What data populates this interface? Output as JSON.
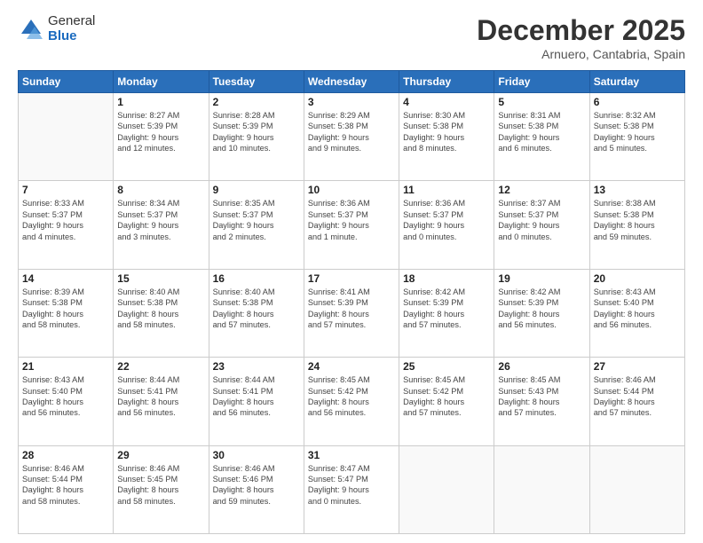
{
  "header": {
    "logo_general": "General",
    "logo_blue": "Blue",
    "month_title": "December 2025",
    "location": "Arnuero, Cantabria, Spain"
  },
  "weekdays": [
    "Sunday",
    "Monday",
    "Tuesday",
    "Wednesday",
    "Thursday",
    "Friday",
    "Saturday"
  ],
  "weeks": [
    [
      {
        "day": "",
        "lines": []
      },
      {
        "day": "1",
        "lines": [
          "Sunrise: 8:27 AM",
          "Sunset: 5:39 PM",
          "Daylight: 9 hours",
          "and 12 minutes."
        ]
      },
      {
        "day": "2",
        "lines": [
          "Sunrise: 8:28 AM",
          "Sunset: 5:39 PM",
          "Daylight: 9 hours",
          "and 10 minutes."
        ]
      },
      {
        "day": "3",
        "lines": [
          "Sunrise: 8:29 AM",
          "Sunset: 5:38 PM",
          "Daylight: 9 hours",
          "and 9 minutes."
        ]
      },
      {
        "day": "4",
        "lines": [
          "Sunrise: 8:30 AM",
          "Sunset: 5:38 PM",
          "Daylight: 9 hours",
          "and 8 minutes."
        ]
      },
      {
        "day": "5",
        "lines": [
          "Sunrise: 8:31 AM",
          "Sunset: 5:38 PM",
          "Daylight: 9 hours",
          "and 6 minutes."
        ]
      },
      {
        "day": "6",
        "lines": [
          "Sunrise: 8:32 AM",
          "Sunset: 5:38 PM",
          "Daylight: 9 hours",
          "and 5 minutes."
        ]
      }
    ],
    [
      {
        "day": "7",
        "lines": [
          "Sunrise: 8:33 AM",
          "Sunset: 5:37 PM",
          "Daylight: 9 hours",
          "and 4 minutes."
        ]
      },
      {
        "day": "8",
        "lines": [
          "Sunrise: 8:34 AM",
          "Sunset: 5:37 PM",
          "Daylight: 9 hours",
          "and 3 minutes."
        ]
      },
      {
        "day": "9",
        "lines": [
          "Sunrise: 8:35 AM",
          "Sunset: 5:37 PM",
          "Daylight: 9 hours",
          "and 2 minutes."
        ]
      },
      {
        "day": "10",
        "lines": [
          "Sunrise: 8:36 AM",
          "Sunset: 5:37 PM",
          "Daylight: 9 hours",
          "and 1 minute."
        ]
      },
      {
        "day": "11",
        "lines": [
          "Sunrise: 8:36 AM",
          "Sunset: 5:37 PM",
          "Daylight: 9 hours",
          "and 0 minutes."
        ]
      },
      {
        "day": "12",
        "lines": [
          "Sunrise: 8:37 AM",
          "Sunset: 5:37 PM",
          "Daylight: 9 hours",
          "and 0 minutes."
        ]
      },
      {
        "day": "13",
        "lines": [
          "Sunrise: 8:38 AM",
          "Sunset: 5:38 PM",
          "Daylight: 8 hours",
          "and 59 minutes."
        ]
      }
    ],
    [
      {
        "day": "14",
        "lines": [
          "Sunrise: 8:39 AM",
          "Sunset: 5:38 PM",
          "Daylight: 8 hours",
          "and 58 minutes."
        ]
      },
      {
        "day": "15",
        "lines": [
          "Sunrise: 8:40 AM",
          "Sunset: 5:38 PM",
          "Daylight: 8 hours",
          "and 58 minutes."
        ]
      },
      {
        "day": "16",
        "lines": [
          "Sunrise: 8:40 AM",
          "Sunset: 5:38 PM",
          "Daylight: 8 hours",
          "and 57 minutes."
        ]
      },
      {
        "day": "17",
        "lines": [
          "Sunrise: 8:41 AM",
          "Sunset: 5:39 PM",
          "Daylight: 8 hours",
          "and 57 minutes."
        ]
      },
      {
        "day": "18",
        "lines": [
          "Sunrise: 8:42 AM",
          "Sunset: 5:39 PM",
          "Daylight: 8 hours",
          "and 57 minutes."
        ]
      },
      {
        "day": "19",
        "lines": [
          "Sunrise: 8:42 AM",
          "Sunset: 5:39 PM",
          "Daylight: 8 hours",
          "and 56 minutes."
        ]
      },
      {
        "day": "20",
        "lines": [
          "Sunrise: 8:43 AM",
          "Sunset: 5:40 PM",
          "Daylight: 8 hours",
          "and 56 minutes."
        ]
      }
    ],
    [
      {
        "day": "21",
        "lines": [
          "Sunrise: 8:43 AM",
          "Sunset: 5:40 PM",
          "Daylight: 8 hours",
          "and 56 minutes."
        ]
      },
      {
        "day": "22",
        "lines": [
          "Sunrise: 8:44 AM",
          "Sunset: 5:41 PM",
          "Daylight: 8 hours",
          "and 56 minutes."
        ]
      },
      {
        "day": "23",
        "lines": [
          "Sunrise: 8:44 AM",
          "Sunset: 5:41 PM",
          "Daylight: 8 hours",
          "and 56 minutes."
        ]
      },
      {
        "day": "24",
        "lines": [
          "Sunrise: 8:45 AM",
          "Sunset: 5:42 PM",
          "Daylight: 8 hours",
          "and 56 minutes."
        ]
      },
      {
        "day": "25",
        "lines": [
          "Sunrise: 8:45 AM",
          "Sunset: 5:42 PM",
          "Daylight: 8 hours",
          "and 57 minutes."
        ]
      },
      {
        "day": "26",
        "lines": [
          "Sunrise: 8:45 AM",
          "Sunset: 5:43 PM",
          "Daylight: 8 hours",
          "and 57 minutes."
        ]
      },
      {
        "day": "27",
        "lines": [
          "Sunrise: 8:46 AM",
          "Sunset: 5:44 PM",
          "Daylight: 8 hours",
          "and 57 minutes."
        ]
      }
    ],
    [
      {
        "day": "28",
        "lines": [
          "Sunrise: 8:46 AM",
          "Sunset: 5:44 PM",
          "Daylight: 8 hours",
          "and 58 minutes."
        ]
      },
      {
        "day": "29",
        "lines": [
          "Sunrise: 8:46 AM",
          "Sunset: 5:45 PM",
          "Daylight: 8 hours",
          "and 58 minutes."
        ]
      },
      {
        "day": "30",
        "lines": [
          "Sunrise: 8:46 AM",
          "Sunset: 5:46 PM",
          "Daylight: 8 hours",
          "and 59 minutes."
        ]
      },
      {
        "day": "31",
        "lines": [
          "Sunrise: 8:47 AM",
          "Sunset: 5:47 PM",
          "Daylight: 9 hours",
          "and 0 minutes."
        ]
      },
      {
        "day": "",
        "lines": []
      },
      {
        "day": "",
        "lines": []
      },
      {
        "day": "",
        "lines": []
      }
    ]
  ]
}
